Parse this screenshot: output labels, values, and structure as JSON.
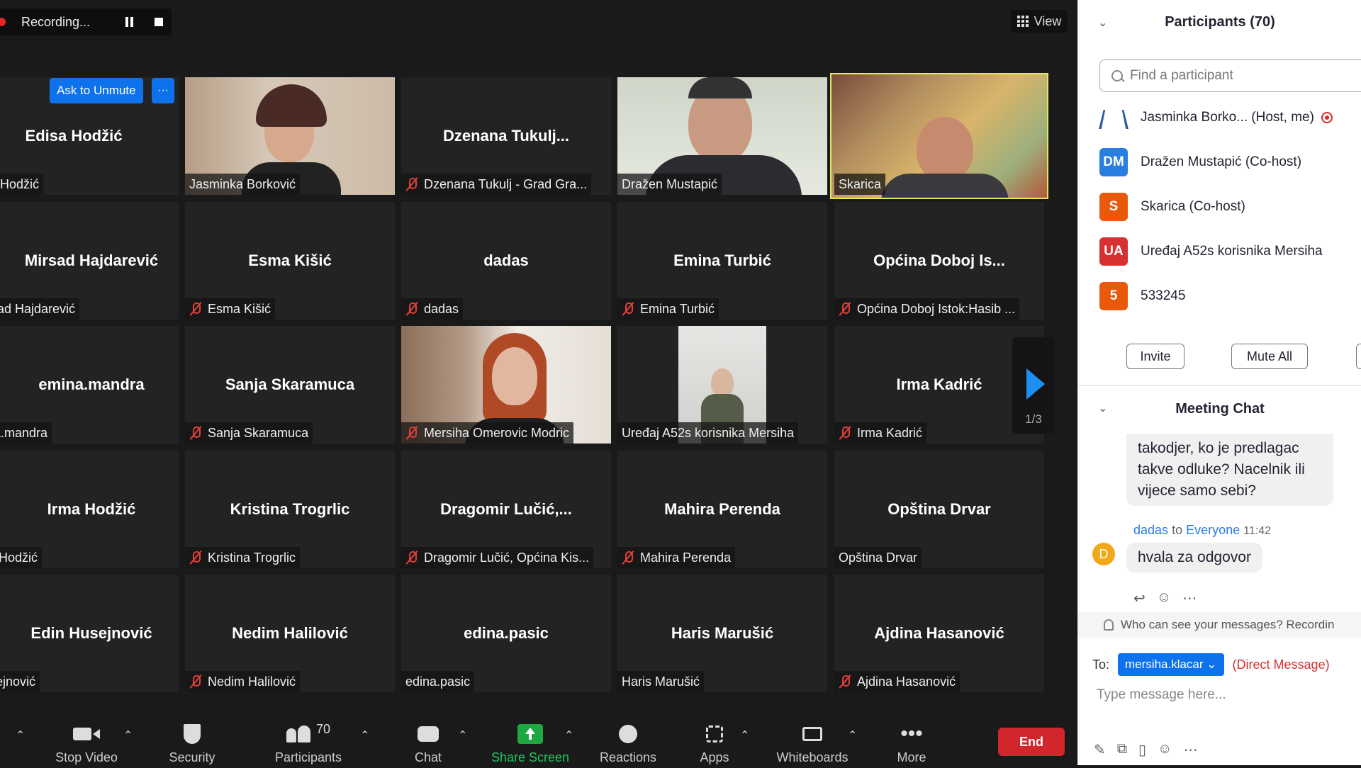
{
  "recording": {
    "label": "Recording...",
    "pause_icon": "pause-icon",
    "stop_icon": "stop-icon"
  },
  "view_button": {
    "label": "View"
  },
  "ask_to_unmute": "Ask to Unmute",
  "more_dots": "···",
  "tiles": [
    {
      "big": "Edisa Hodžić",
      "label": "disa Hodžić",
      "muted": false,
      "video": false
    },
    {
      "big": "",
      "label": "Jasminka Borković",
      "muted": false,
      "video": true
    },
    {
      "big": "Dzenana  Tukulj...",
      "label": "Dzenana Tukulj - Grad Gra...",
      "muted": true,
      "video": false
    },
    {
      "big": "",
      "label": "Dražen Mustapić",
      "muted": false,
      "video": true
    },
    {
      "big": "",
      "label": "Skarica",
      "muted": false,
      "video": true,
      "speaking": true
    },
    {
      "big": "Mirsad Hajdarević",
      "label": "Mirsad Hajdarević",
      "muted": false,
      "video": false
    },
    {
      "big": "Esma Kišić",
      "label": "Esma Kišić",
      "muted": true,
      "video": false
    },
    {
      "big": "dadas",
      "label": "dadas",
      "muted": true,
      "video": false
    },
    {
      "big": "Emina Turbić",
      "label": "Emina Turbić",
      "muted": true,
      "video": false
    },
    {
      "big": "Općina  Doboj  Is...",
      "label": "Općina Doboj Istok:Hasib ...",
      "muted": true,
      "video": false
    },
    {
      "big": "emina.mandra",
      "label": "mina.mandra",
      "muted": false,
      "video": false
    },
    {
      "big": "Sanja Skaramuca",
      "label": "Sanja Skaramuca",
      "muted": true,
      "video": false
    },
    {
      "big": "",
      "label": "Mersiha Omerovic Modric",
      "muted": true,
      "video": true
    },
    {
      "big": "",
      "label": "Uređaj A52s korisnika Mersiha",
      "muted": false,
      "video": true
    },
    {
      "big": "Irma Kadrić",
      "label": "Irma Kadrić",
      "muted": true,
      "video": false
    },
    {
      "big": "Irma Hodžić",
      "label": "rma Hodžić",
      "muted": false,
      "video": false
    },
    {
      "big": "Kristina Trogrlic",
      "label": "Kristina Trogrlic",
      "muted": true,
      "video": false
    },
    {
      "big": "Dragomir  Lučić,...",
      "label": "Dragomir Lučić, Općina Kis...",
      "muted": true,
      "video": false
    },
    {
      "big": "Mahira Perenda",
      "label": "Mahira Perenda",
      "muted": true,
      "video": false
    },
    {
      "big": "Opština Drvar",
      "label": "Opština Drvar",
      "muted": false,
      "video": false
    },
    {
      "big": "Edin Husejnović",
      "label": "Husejnović",
      "muted": false,
      "video": false
    },
    {
      "big": "Nedim Halilović",
      "label": "Nedim Halilović",
      "muted": true,
      "video": false
    },
    {
      "big": "edina.pasic",
      "label": "edina.pasic",
      "muted": false,
      "video": false
    },
    {
      "big": "Haris Marušić",
      "label": "Haris Marušić",
      "muted": false,
      "video": false
    },
    {
      "big": "Ajdina Hasanović",
      "label": "Ajdina Hasanović",
      "muted": true,
      "video": false
    }
  ],
  "pagination": {
    "label": "1/3"
  },
  "toolbar": {
    "stop_video": "Stop Video",
    "security": "Security",
    "participants": "Participants",
    "participants_count": "70",
    "chat": "Chat",
    "share_screen": "Share Screen",
    "reactions": "Reactions",
    "apps": "Apps",
    "whiteboards": "Whiteboards",
    "more": "More",
    "end": "End",
    "caret": "⌃"
  },
  "participants_panel": {
    "title": "Participants (70)",
    "search_placeholder": "Find a participant",
    "rows": [
      {
        "initials": "",
        "name": "Jasminka Borko...  (Host, me)",
        "avatar_color": "logo"
      },
      {
        "initials": "DM",
        "name": "Dražen Mustapić (Co-host)",
        "avatar_color": "#2a7de1"
      },
      {
        "initials": "S",
        "name": "Skarica (Co-host)",
        "avatar_color": "#e8590c"
      },
      {
        "initials": "UA",
        "name": "Uređaj A52s korisnika Mersiha",
        "avatar_color": "#d63030"
      },
      {
        "initials": "5",
        "name": "533245",
        "avatar_color": "#e8590c"
      }
    ],
    "invite": "Invite",
    "mute_all": "Mute All"
  },
  "chat_panel": {
    "title": "Meeting Chat",
    "prev_message": "takodjer, ko je predlagac takve odluke? Nacelnik ili vijece samo sebi?",
    "sender": "dadas",
    "to_word": "to",
    "recipient": "Everyone",
    "time": "11:42",
    "avatar_letter": "D",
    "message": "hvala za odgovor",
    "who_can_see": "Who can see your messages? Recordin",
    "to_label": "To:",
    "to_recipient": "mersiha.klacar",
    "direct_message": "(Direct Message)",
    "input_placeholder": "Type message here..."
  }
}
